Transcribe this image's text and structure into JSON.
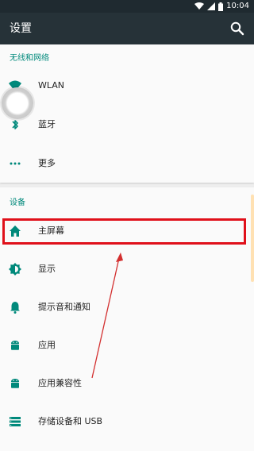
{
  "status_bar": {
    "time": "10:04"
  },
  "toolbar": {
    "title": "设置",
    "search_icon": "search-icon"
  },
  "sections": {
    "wireless": {
      "header": "无线和网络",
      "items": [
        {
          "label": "WLAN",
          "icon": "wifi-icon"
        },
        {
          "label": "蓝牙",
          "icon": "bluetooth-icon"
        },
        {
          "label": "更多",
          "icon": "more-icon"
        }
      ]
    },
    "device": {
      "header": "设备",
      "items": [
        {
          "label": "主屏幕",
          "icon": "home-icon"
        },
        {
          "label": "显示",
          "icon": "brightness-icon"
        },
        {
          "label": "提示音和通知",
          "icon": "bell-icon"
        },
        {
          "label": "应用",
          "icon": "android-icon"
        },
        {
          "label": "应用兼容性",
          "icon": "android-icon"
        },
        {
          "label": "存储设备和 USB",
          "icon": "storage-icon"
        }
      ]
    }
  },
  "colors": {
    "accent": "#00897b",
    "toolbar": "#263238",
    "highlight": "#e0101a"
  }
}
